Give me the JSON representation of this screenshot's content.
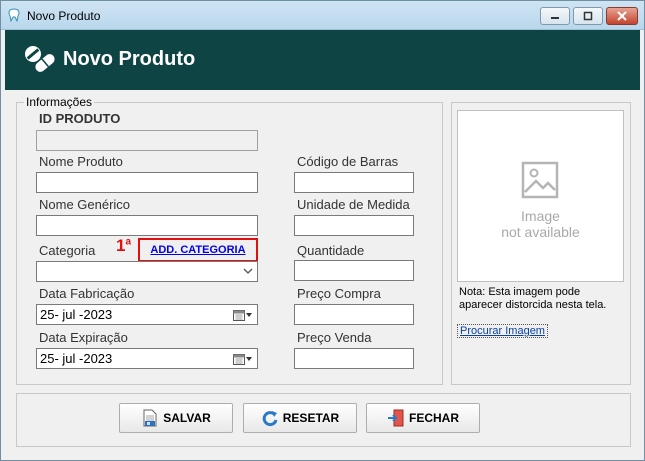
{
  "window": {
    "title": "Novo Produto"
  },
  "header": {
    "title": "Novo Produto"
  },
  "form": {
    "group_label": "Informações",
    "id_label": "ID PRODUTO",
    "id_value": "",
    "nome_label": "Nome Produto",
    "nome_value": "",
    "codigo_label": "Código de Barras",
    "codigo_value": "",
    "generico_label": "Nome Genérico",
    "generico_value": "",
    "unidade_label": "Unidade de Medida",
    "unidade_value": "",
    "categoria_label": "Categoria",
    "categoria_value": "",
    "add_categoria_label": "ADD. CATEGORIA",
    "quantidade_label": "Quantidade",
    "quantidade_value": "",
    "fabricacao_label": "Data Fabricação",
    "fabricacao_value": "25- jul -2023",
    "preco_compra_label": "Preço Compra",
    "preco_compra_value": "",
    "expiracao_label": "Data Expiração",
    "expiracao_value": "25- jul -2023",
    "preco_venda_label": "Preço Venda",
    "preco_venda_value": ""
  },
  "annotation": {
    "number": "1",
    "suffix": "a"
  },
  "image_panel": {
    "placeholder_line1": "Image",
    "placeholder_line2": "not available",
    "note": "Nota: Esta imagem pode aparecer distorcida nesta tela.",
    "browse_link": "Procurar Imagem"
  },
  "buttons": {
    "salvar": "SALVAR",
    "resetar": "RESETAR",
    "fechar": "FECHAR"
  },
  "colors": {
    "header_bg": "#0e4444",
    "annotation_red": "#e01010",
    "link_blue": "#0000ee"
  }
}
